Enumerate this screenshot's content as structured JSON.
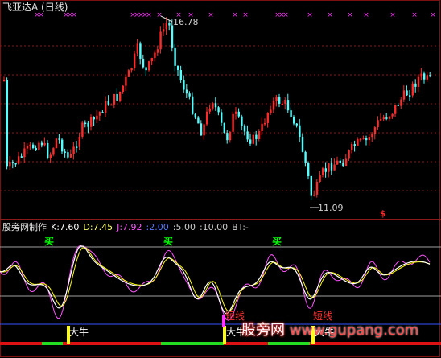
{
  "stock": {
    "title": "飞亚达A (日线)",
    "high_label": "16.78",
    "low_label": "11.09",
    "marker": "$"
  },
  "indicator": {
    "title": "股旁网制作",
    "k": "K:7.60",
    "d": "D:7.45",
    "j": "J:7.92",
    "p1": ":2.00",
    "p2": ":5.00",
    "p3": ":10.00",
    "bt": "BT:-"
  },
  "signals": {
    "buy_label": "买",
    "bull_label": "大牛",
    "warn_label": "短线"
  },
  "watermark": {
    "name": "股旁网",
    "url": "www.gupang.com"
  },
  "colors": {
    "up": "#ff2a2a",
    "down": "#55ffff",
    "k_line": "#ffffff",
    "d_line": "#ffff00",
    "j_line": "#ff55ff",
    "guide": "#a0a0a0",
    "blue_line": "#3355ff"
  }
}
